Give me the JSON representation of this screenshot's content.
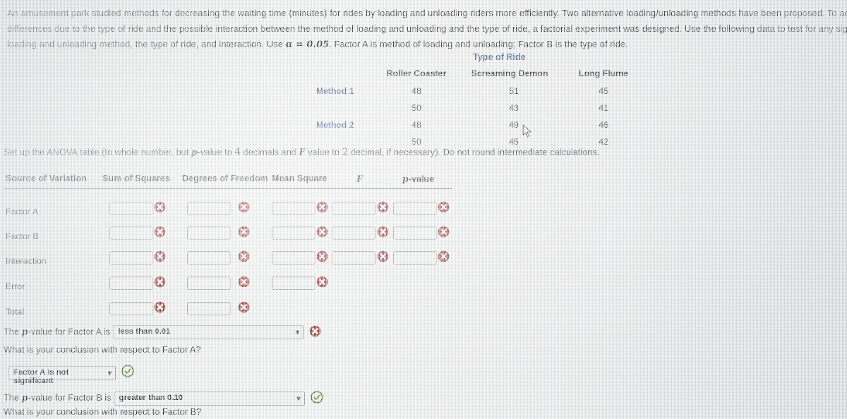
{
  "problem": {
    "line1": "An amusement park studied methods for decreasing the waiting time (minutes) for rides by loading and unloading riders more efficiently. Two alternative loading/unloading methods have been proposed. To account for pot",
    "line2": "differences due to the type of ride and the possible interaction between the method of loading and unloading and the type of ride, a factorial experiment was designed. Use the following data to test for any significant effec",
    "line3_a": "loading and unloading method, the type of ride, and interaction. Use ",
    "line3_alpha": "α = 0.05",
    "line3_b": ". Factor A is method of loading and unloading; Factor B is the type of ride."
  },
  "data_table": {
    "title": "Type of Ride",
    "columns": [
      "Roller Coaster",
      "Screaming Demon",
      "Long Flume"
    ],
    "rows": [
      {
        "label": "Method 1",
        "values": [
          "48",
          "51",
          "45"
        ]
      },
      {
        "label": "",
        "values": [
          "50",
          "43",
          "41"
        ]
      },
      {
        "label": "Method 2",
        "values": [
          "48",
          "49",
          "46"
        ]
      },
      {
        "label": "",
        "values": [
          "50",
          "45",
          "42"
        ]
      }
    ]
  },
  "setup": {
    "text_a": "Set up the ANOVA table (to whole number, but ",
    "text_p": "p",
    "text_b": "-value to ",
    "text_4": "4",
    "text_c": " decimals and ",
    "text_F": "F",
    "text_d": " value to ",
    "text_2": "2",
    "text_e": " decimal, if necessary). Do not round intermediate calculations."
  },
  "anova": {
    "headers": {
      "source": "Source of Variation",
      "ss": "Sum of Squares",
      "df": "Degrees of Freedom",
      "ms": "Mean Square",
      "f": "F",
      "p_italic": "p",
      "p_rest": "-value"
    },
    "rows": [
      {
        "label": "Factor A",
        "cells": [
          "",
          "",
          "",
          "",
          ""
        ],
        "status": [
          "error",
          "error",
          "error",
          "error",
          "error"
        ]
      },
      {
        "label": "Factor B",
        "cells": [
          "",
          "",
          "",
          "",
          ""
        ],
        "status": [
          "error",
          "error",
          "error",
          "error",
          "error"
        ]
      },
      {
        "label": "Interaction",
        "cells": [
          "",
          "",
          "",
          "",
          ""
        ],
        "status": [
          "error",
          "error",
          "error",
          "error",
          "error"
        ]
      },
      {
        "label": "Error",
        "cells": [
          "",
          "",
          ""
        ],
        "status": [
          "error",
          "error",
          "error"
        ]
      },
      {
        "label": "Total",
        "cells": [
          "",
          ""
        ],
        "status": [
          "error",
          "error"
        ]
      }
    ]
  },
  "questions": {
    "p_factor_a_prefix": "The ",
    "p_italic": "p",
    "p_factor_a_mid": "-value for Factor A is",
    "p_factor_a_value": "less than 0.01",
    "p_factor_a_status": "error",
    "conclusion_a_question": "What is your conclusion with respect to Factor A?",
    "conclusion_a_value": "Factor A is not significant",
    "conclusion_a_status": "correct",
    "p_factor_b_mid": "-value for Factor B is",
    "p_factor_b_value": "greater than 0.10",
    "p_factor_b_status": "correct",
    "conclusion_b_question": "What is your conclusion with respect to Factor B?"
  },
  "icons": {
    "error": "x-circle-icon",
    "correct": "check-circle-icon",
    "dropdown": "chevron-down-icon",
    "cursor": "mouse-pointer-icon"
  },
  "colors": {
    "error_red": "#8e2a26",
    "correct_green": "#4e7a2b",
    "heading_blue": "#2f4f86",
    "page_bg": "#eceeee"
  }
}
